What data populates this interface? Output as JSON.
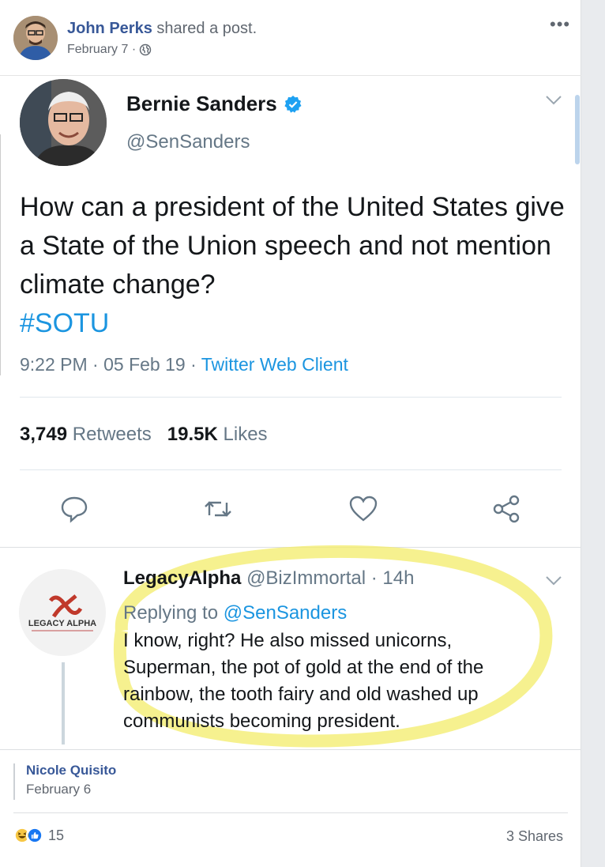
{
  "post": {
    "author": "John Perks",
    "action": "shared a post.",
    "date": "February 7 ·",
    "privacy_icon": "globe-icon",
    "more_label": "•••"
  },
  "tweet": {
    "name": "Bernie Sanders",
    "handle": "@SenSanders",
    "text": "How can a president of the United States give a State of the Union speech and not mention climate change?",
    "hashtag": "#SOTU",
    "time": "9:22 PM · 05 Feb 19 · ",
    "client": "Twitter Web Client",
    "retweets_count": "3,749",
    "retweets_label": "Retweets",
    "likes_count": "19.5K",
    "likes_label": "Likes",
    "colors": {
      "link": "#1b95e0",
      "verified": "#1da1f2",
      "text": "#14171a",
      "muted": "#657786"
    }
  },
  "reply": {
    "name": "LegacyAlpha",
    "handle": "@BizImmortal · 14h",
    "replying_prefix": "Replying to ",
    "replying_to": "@SenSanders",
    "text": "I know, right? He also missed unicorns, Superman, the pot of gold at the end of the rainbow, the tooth fairy and old washed up communists becoming president.",
    "logo_text": "LEGACY ALPHA",
    "highlight_color": "#f3ec6a"
  },
  "shared_by": {
    "name": "Nicole Quisito",
    "date": "February 6"
  },
  "footer": {
    "reactions_count": "15",
    "shares": "3 Shares"
  }
}
